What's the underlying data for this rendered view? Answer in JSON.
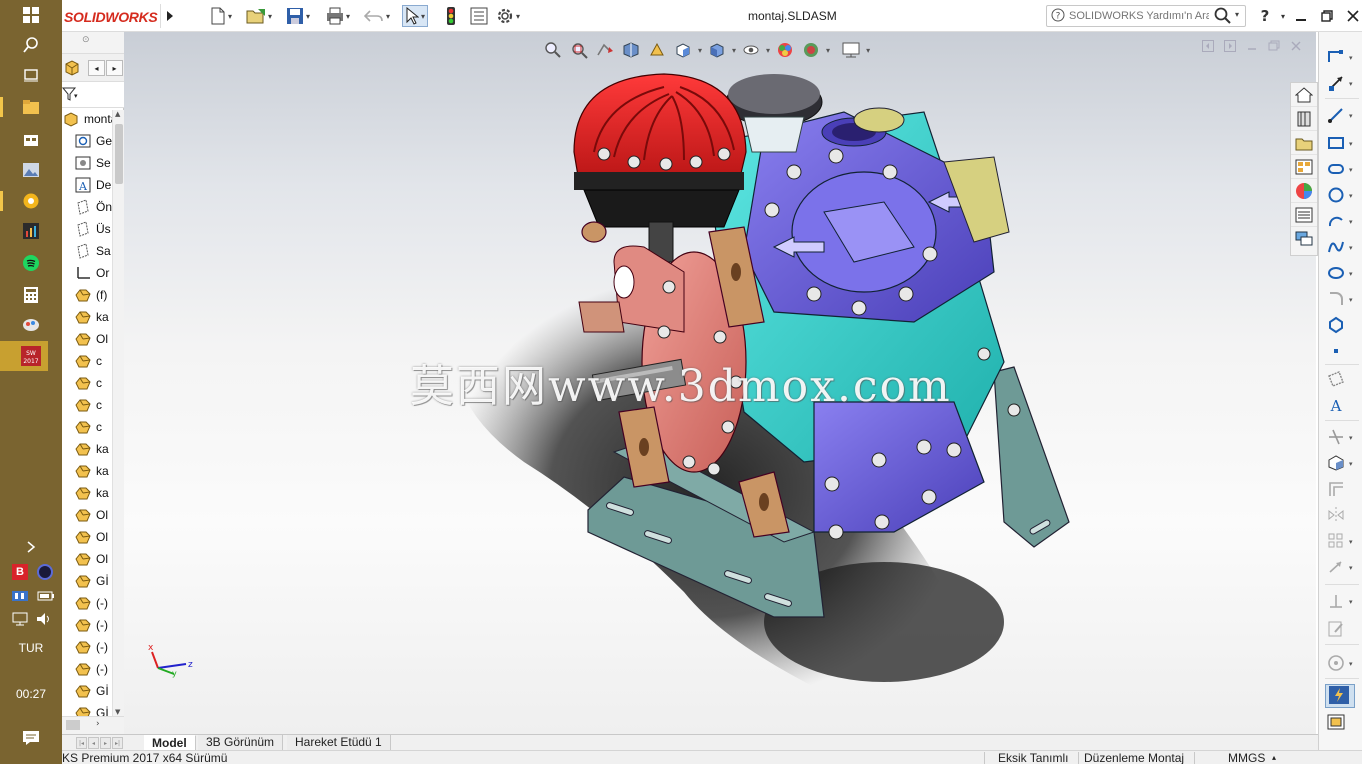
{
  "taskbar": {
    "language": "TUR",
    "clock": "00:27",
    "icons": [
      "windows-logo-icon",
      "search-icon",
      "task-view-icon",
      "file-explorer-icon",
      "store-icon",
      "photos-icon",
      "chrome-icon",
      "app-chart-icon",
      "spotify-icon",
      "calculator-icon",
      "paint-icon",
      "solidworks-2017-icon"
    ],
    "tray_icons": [
      "chevron-right-icon",
      "b-app-icon",
      "circle-app-icon",
      "keyboard-icon",
      "battery-icon",
      "network-icon",
      "volume-icon",
      "notifications-icon"
    ]
  },
  "titlebar": {
    "brand": "SOLIDWORKS",
    "document_title": "montaj.SLDASM",
    "help_search_placeholder": "SOLIDWORKS Yardımı'n Ara",
    "help_label": "?",
    "quick_access": [
      "new-icon",
      "open-icon",
      "save-icon",
      "print-icon",
      "undo-icon",
      "select-icon",
      "rebuild-icon",
      "file-properties-icon",
      "options-icon"
    ]
  },
  "feature_tree": {
    "root": "montaj",
    "items": [
      {
        "icon": "history-icon",
        "label": "Ge"
      },
      {
        "icon": "sensors-icon",
        "label": "Se"
      },
      {
        "icon": "annotations-icon",
        "label": "De"
      },
      {
        "icon": "plane-icon",
        "label": "Ön"
      },
      {
        "icon": "plane-icon",
        "label": "Üs"
      },
      {
        "icon": "plane-icon",
        "label": "Sa"
      },
      {
        "icon": "origin-icon",
        "label": "Or"
      },
      {
        "icon": "part-icon",
        "label": "(f)"
      },
      {
        "icon": "part-icon",
        "label": "ka"
      },
      {
        "icon": "part-icon",
        "label": "Ol"
      },
      {
        "icon": "part-icon",
        "label": "c"
      },
      {
        "icon": "part-icon",
        "label": "c"
      },
      {
        "icon": "part-icon",
        "label": "c"
      },
      {
        "icon": "part-icon",
        "label": "c"
      },
      {
        "icon": "part-icon",
        "label": "ka"
      },
      {
        "icon": "part-icon",
        "label": "ka"
      },
      {
        "icon": "part-icon",
        "label": "ka"
      },
      {
        "icon": "part-icon",
        "label": "Ol"
      },
      {
        "icon": "part-icon",
        "label": "Ol"
      },
      {
        "icon": "part-icon",
        "label": "Ol"
      },
      {
        "icon": "part-icon",
        "label": "Gİ"
      },
      {
        "icon": "part-icon",
        "label": "(-)"
      },
      {
        "icon": "part-icon",
        "label": "(-)"
      },
      {
        "icon": "part-icon",
        "label": "(-)"
      },
      {
        "icon": "part-icon",
        "label": "(-)"
      },
      {
        "icon": "part-icon",
        "label": "Gİ"
      },
      {
        "icon": "part-icon",
        "label": "Gİ"
      }
    ]
  },
  "viewport": {
    "watermark": "莫西网www.3dmox.com",
    "triad_labels": {
      "x": "x",
      "y": "y",
      "z": "z"
    }
  },
  "bottom_tabs": [
    {
      "label": "Model",
      "active": true
    },
    {
      "label": "3B Görünüm",
      "active": false
    },
    {
      "label": "Hareket Etüdü 1",
      "active": false
    }
  ],
  "status": {
    "product": "KS Premium 2017 x64 Sürümü",
    "definition": "Eksik Tanımlı",
    "mode": "Düzenleme Montaj",
    "units": "MMGS"
  },
  "colors": {
    "taskbar": "#7a6430",
    "brand_red": "#d52b1e",
    "pump_blue": "#6a5fd8",
    "pump_cyan": "#2fd4cf",
    "pump_red": "#d42020",
    "pump_salmon": "#e07a72",
    "bracket_teal": "#6e9a96",
    "bronze": "#c99565"
  }
}
